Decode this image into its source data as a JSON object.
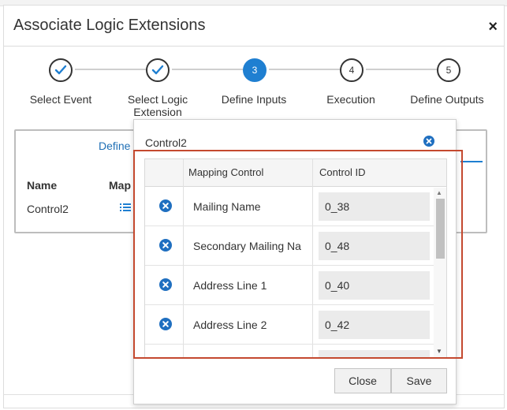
{
  "dialog": {
    "title": "Associate Logic Extensions",
    "close_glyph": "×"
  },
  "steps": [
    {
      "number": "",
      "label": "Select Event",
      "state": "done"
    },
    {
      "number": "",
      "label": "Select Logic Extension",
      "state": "done"
    },
    {
      "number": "3",
      "label": "Define Inputs",
      "state": "active"
    },
    {
      "number": "4",
      "label": "Execution",
      "state": "pending"
    },
    {
      "number": "5",
      "label": "Define Outputs",
      "state": "pending"
    }
  ],
  "background_panel": {
    "tab_label": "Define",
    "col_name": "Name",
    "col_mapping": "Map",
    "row_name": "Control2"
  },
  "popup": {
    "title": "Control2",
    "columns": {
      "mapping": "Mapping Control",
      "control_id": "Control ID"
    },
    "rows": [
      {
        "name": "Mailing Name",
        "control_id": "0_38"
      },
      {
        "name": "Secondary Mailing Na",
        "control_id": "0_48"
      },
      {
        "name": "Address Line 1",
        "control_id": "0_40"
      },
      {
        "name": "Address Line 2",
        "control_id": "0_42"
      }
    ],
    "buttons": {
      "close": "Close",
      "save": "Save"
    }
  },
  "colors": {
    "accent": "#1f7fd1",
    "highlight": "#c4492f",
    "input_bg": "#ebebeb"
  },
  "icons": [
    "check-icon",
    "close-icon",
    "remove-circle-icon",
    "list-icon",
    "scroll-up-icon",
    "scroll-down-icon"
  ]
}
